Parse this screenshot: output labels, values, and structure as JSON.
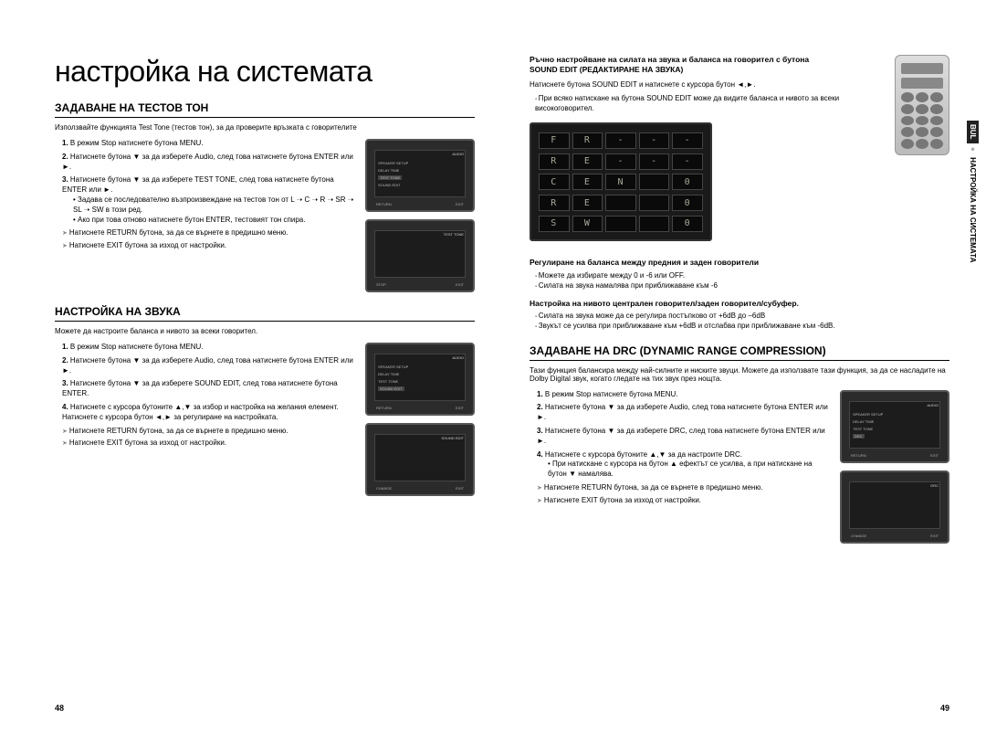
{
  "left": {
    "main_title": "настройка на системата",
    "sec1": {
      "heading": "ЗАДАВАНЕ НА ТЕСТОВ ТОН",
      "intro": "Използвайте функцията Test Tone (тестов тон), за да проверите връзката с говорителите",
      "step1": "В режим Stop натиснете бутона MENU.",
      "step2": "Натиснете бутона ▼ за да изберете Audio, след това натиснете бутона ENTER или ►.",
      "step3": "Натиснете бутона ▼ за да изберете TEST TONE, след това натиснете бутона ENTER или ►.",
      "sub1": "Задава се последователно възпроизвеждане на тестов тон от L ➝ C ➝ R ➝ SR ➝ SL ➝ SW в този ред.",
      "sub2": "Ако при това отново натиснете бутон ENTER, тестовият тон спира.",
      "ret": "Натиснете RETURN бутона, за да се върнете в предишно меню.",
      "exit": "Натиснете EXIT бутона за изход от настройки."
    },
    "sec2": {
      "heading": "НАСТРОЙКА НА ЗВУКА",
      "intro": "Можете да настроите баланса и нивото за всеки говорител.",
      "step1": "В режим Stop натиснете бутона MENU.",
      "step2": "Натиснете бутона ▼ за да изберете Audio, след това натиснете бутона ENTER или ►.",
      "step3": "Натиснете бутона ▼ за да изберете SOUND EDIT, след това натиснете бутона ENTER.",
      "step4": "Натиснете с курсора бутоните ▲,▼ за избор и настройка на желания елемент. Натиснете с курсора бутон ◄,► за регулиране на настройката.",
      "ret": "Натиснете RETURN бутона, за да се върнете в предишно меню.",
      "exit": "Натиснете EXIT бутона за изход от настройки."
    },
    "page_num": "48"
  },
  "right": {
    "banner1": "Ръчно настройване на силата на звука и баланса на говорител с бутона",
    "banner2": "SOUND EDIT (РЕДАКТИРАНЕ НА ЗВУКА)",
    "p1": "Натиснете бутона SOUND EDIT и натиснете с курсора бутон ◄,►.",
    "b1": "При всяко натискане на бутона SOUND EDIT може да видите баланса и нивото за всеки високоговорител.",
    "seg": [
      [
        "F",
        "R",
        "-",
        "-",
        "-"
      ],
      [
        "R",
        "E",
        "-",
        "-",
        "-"
      ],
      [
        "C",
        "E",
        "N",
        " ",
        "0"
      ],
      [
        "R",
        "E",
        " ",
        " ",
        "0"
      ],
      [
        "S",
        "W",
        " ",
        " ",
        "0"
      ]
    ],
    "sub1_h": "Регулиране на баланса между предния и заден говорители",
    "sub1_a": "Можете да избирате между 0 и -6 или OFF.",
    "sub1_b": "Силата на звука намалява при приближаване към -6",
    "sub2_h": "Настройка на нивото централен говорител/заден говорител/субуфер.",
    "sub2_a": "Силата на звука може да се регулира постъпково от +6dB до –6dB",
    "sub2_b": "Звукът се усилва при приближаване към +6dB и отслабва при приближаване към -6dB.",
    "sec3": {
      "heading": "ЗАДАВАНЕ НА DRC (DYNAMIC RANGE COMPRESSION)",
      "intro": "Тази функция балансира между най-силните и ниските звуци. Можете да използвате тази функция, за да се насладите на Dolby Digital звук, когато гледате на тих звук през нощта.",
      "step1": "В режим Stop натиснете бутона MENU.",
      "step2": "Натиснете бутона ▼ за да изберете Audio, след това натиснете бутона ENTER или ►.",
      "step3": "Натиснете бутона ▼ за да изберете DRC, след това натиснете бутона ENTER или ►.",
      "step4": "Натиснете с курсора бутоните ▲,▼ за да настроите DRC.",
      "sub1": "При натискане с курсора на бутон ▲ ефектът се усилва, а при натискане на бутон ▼ намалява.",
      "ret": "Натиснете RETURN бутона, за да се върнете в предишно меню.",
      "exit": "Натиснете EXIT бутона за изход от настройки."
    },
    "tab_lang": "BUL",
    "tab_label": "НАСТРОЙКА НА СИСТЕМАТА",
    "page_num": "49"
  },
  "tv": {
    "audio": "AUDIO",
    "testtone": "TEST TONE",
    "soundedit": "SOUND EDIT",
    "drc": "DRC",
    "speaker": "SPEAKER SETUP",
    "delay": "DELAY TIME",
    "return": "RETURN",
    "exit": "EXIT",
    "change": "CHANGE",
    "stop": "STOP"
  }
}
